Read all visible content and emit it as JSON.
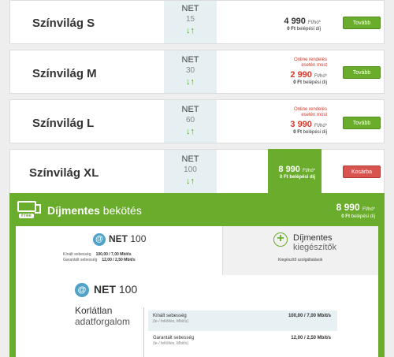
{
  "plans": [
    {
      "name": "Színvilág S",
      "net_label": "NET",
      "speed": "15",
      "promo": [],
      "price": "4 990",
      "unit": "Ft/hó*",
      "fee_amount": "0 Ft",
      "fee_text": "belépési díj",
      "button": "Tovább"
    },
    {
      "name": "Színvilág M",
      "net_label": "NET",
      "speed": "30",
      "promo": [
        "Online rendelés",
        "esetén most"
      ],
      "price": "2 990",
      "unit": "Ft/hó*",
      "fee_amount": "0 Ft",
      "fee_text": "belépési díj",
      "button": "Tovább"
    },
    {
      "name": "Színvilág L",
      "net_label": "NET",
      "speed": "60",
      "promo": [
        "Online rendelés",
        "esetén most"
      ],
      "price": "3 990",
      "unit": "Ft/hó*",
      "fee_amount": "0 Ft",
      "fee_text": "belépési díj",
      "button": "Tovább"
    },
    {
      "name": "Színvilág XL",
      "net_label": "NET",
      "speed": "100",
      "promo": [],
      "price": "8 990",
      "unit": "Ft/hó*",
      "fee_amount": "0 Ft",
      "fee_text": "belépési díj",
      "button": "Kosárba"
    }
  ],
  "arrows": "↓↑",
  "panel": {
    "badge": "Free",
    "title_bold": "Díjmentes",
    "title_rest": " bekötés",
    "price": "8 990",
    "unit": "Ft/hó*",
    "fee_amount": "0 Ft",
    "fee_text": "belépési díj"
  },
  "tab_net": {
    "at": "@",
    "label": "NET",
    "speed": "100",
    "rows": [
      {
        "label": "Kínált sebesség",
        "value": "100,00 / 7,00 Mbit/s"
      },
      {
        "label": "Garantált sebesség",
        "value": "12,00 / 2,50 Mbit/s"
      }
    ]
  },
  "tab_extras": {
    "plus": "+",
    "title1": "Díjmentes",
    "title2": "kiegészítők",
    "sub": "Kiegészítő szolgáltatások"
  },
  "detail": {
    "at": "@",
    "label": "NET",
    "speed": "100",
    "line1": "Korlátlan",
    "line2": "adatforgalom",
    "specs": [
      {
        "label": "Kínált sebesség",
        "sub": "(le-/ feltöltés, Mbit/s)",
        "value": "100,00 / 7,00 Mbit/s"
      },
      {
        "label": "Garantált sebesség",
        "sub": "(le-/ feltöltés, Mbit/s)",
        "value": "12,00 / 2,50 Mbit/s"
      }
    ]
  },
  "colors": {
    "green": "#6aac2b",
    "red": "#d43a2b",
    "net_bg": "#e6f0f3"
  }
}
